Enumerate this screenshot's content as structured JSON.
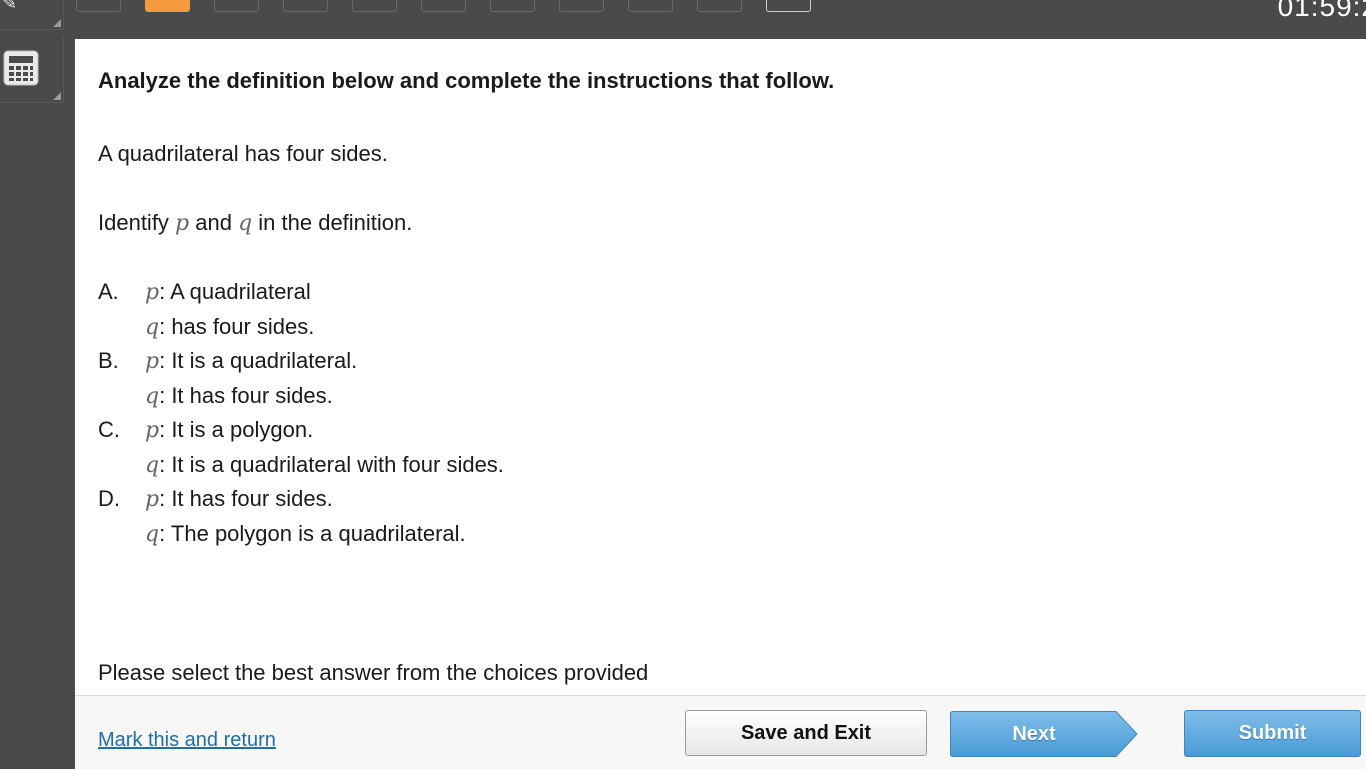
{
  "toolbar": {
    "timer": "01:59:2",
    "question_nav": [
      {
        "state": "default"
      },
      {
        "state": "current"
      },
      {
        "state": "default"
      },
      {
        "state": "default"
      },
      {
        "state": "default"
      },
      {
        "state": "default"
      },
      {
        "state": "default"
      },
      {
        "state": "default"
      },
      {
        "state": "default"
      },
      {
        "state": "default"
      },
      {
        "state": "outlined"
      }
    ],
    "accent_color": "#f39a3c"
  },
  "sidebar": {
    "tools": [
      {
        "icon": "pencil-icon"
      },
      {
        "icon": "calculator-icon"
      }
    ]
  },
  "question": {
    "instructions": "Analyze the definition below and complete the instructions that follow.",
    "definition": "A quadrilateral has four sides.",
    "prompt_before_p": "Identify ",
    "var_p": "p",
    "prompt_between": " and ",
    "var_q": "q",
    "prompt_after_q": " in the definition.",
    "choices": [
      {
        "letter": "A.",
        "p_text": ": A quadrilateral",
        "q_text": ": has four sides."
      },
      {
        "letter": "B.",
        "p_text": ": It is a quadrilateral.",
        "q_text": ": It has four sides."
      },
      {
        "letter": "C.",
        "p_text": ": It is a polygon.",
        "q_text": ": It is a quadrilateral with four sides."
      },
      {
        "letter": "D.",
        "p_text": ": It has four sides.",
        "q_text": ": The polygon is a quadrilateral."
      }
    ],
    "select_hint": "Please select the best answer from the choices provided"
  },
  "footer": {
    "mark_link": "Mark this and return",
    "save_exit_label": "Save and Exit",
    "next_label": "Next",
    "submit_label": "Submit",
    "button_blue": "#5aa8e0"
  }
}
